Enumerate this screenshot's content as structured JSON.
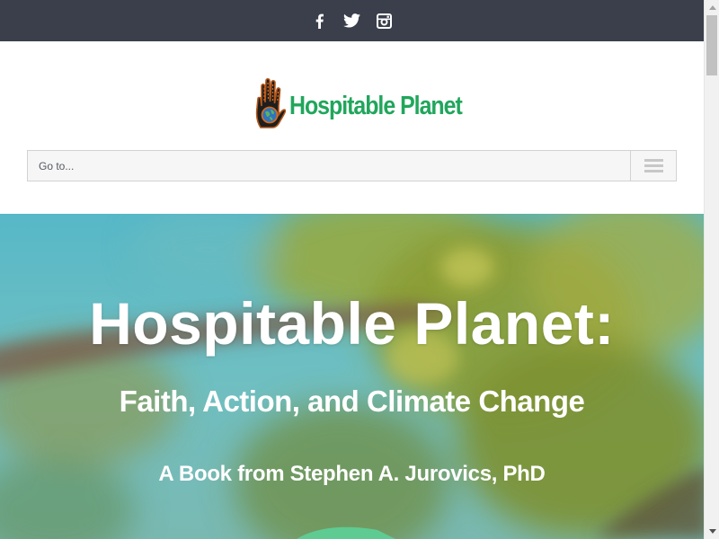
{
  "social": {
    "icons": [
      "facebook-icon",
      "twitter-icon",
      "instagram-icon"
    ],
    "bar_color": "#3a3f4b"
  },
  "header": {
    "logo_text": "Hospitable Planet",
    "logo_color": "#21a65c",
    "nav_label": "Go to..."
  },
  "hero": {
    "title": "Hospitable Planet:",
    "subtitle": "Faith, Action, and Climate Change",
    "author_line": "A Book from Stephen A. Jurovics, PhD"
  }
}
